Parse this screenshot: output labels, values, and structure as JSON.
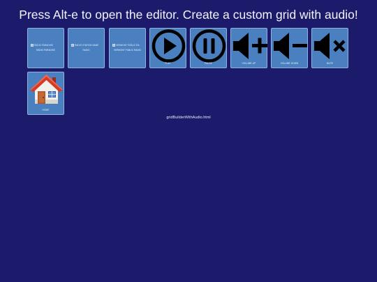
{
  "page": {
    "title": "Press Alt-e to open the editor. Create a custom grid with audio!",
    "footer": "gridBuilderWithAudio.html"
  },
  "tiles": [
    {
      "label": "Radio Paradise",
      "alt": "Radio Paradise",
      "icon": "broken-image-icon"
    },
    {
      "label": "Radio",
      "alt": "Radio station name",
      "icon": "broken-image-icon"
    },
    {
      "label": "Vermont Public Radio",
      "alt": "Vermont Public Ra",
      "icon": "broken-image-icon"
    },
    {
      "label": "Play",
      "icon": "play-icon"
    },
    {
      "label": "Pause",
      "icon": "pause-icon"
    },
    {
      "label": "Volume Up",
      "icon": "volume-up-icon"
    },
    {
      "label": "Volume Down",
      "icon": "volume-down-icon"
    },
    {
      "label": "Mute",
      "icon": "mute-icon"
    },
    {
      "label": "Home",
      "icon": "home-icon"
    }
  ],
  "colors": {
    "background": "#1b1a6b",
    "tile": "#4a80bf",
    "tile_border": "#8fb3dc",
    "text": "#f3f3fb"
  }
}
